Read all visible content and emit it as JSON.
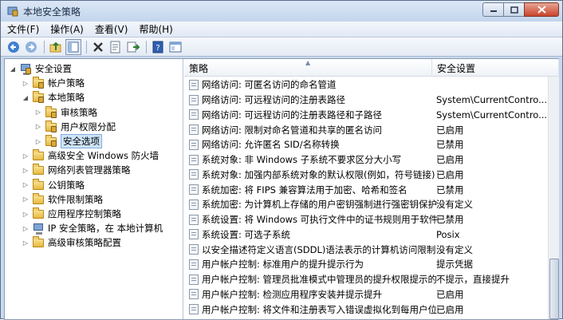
{
  "window": {
    "title": "本地安全策略"
  },
  "menu": [
    "文件(F)",
    "操作(A)",
    "查看(V)",
    "帮助(H)"
  ],
  "toolbar": [
    "back-icon",
    "forward-icon",
    "up-folder-icon",
    "show-hide-tree-icon",
    "delete-icon",
    "properties-icon",
    "export-icon",
    "help-icon",
    "console-icon"
  ],
  "tree": [
    {
      "label": "安全设置",
      "level": 0,
      "expanded": true,
      "icon": "computer-icon"
    },
    {
      "label": "帐户策略",
      "level": 1,
      "expanded": false,
      "icon": "folder-lock-icon"
    },
    {
      "label": "本地策略",
      "level": 1,
      "expanded": true,
      "icon": "folder-lock-icon"
    },
    {
      "label": "审核策略",
      "level": 2,
      "expanded": false,
      "icon": "folder-lock-icon"
    },
    {
      "label": "用户权限分配",
      "level": 2,
      "expanded": false,
      "icon": "folder-lock-icon"
    },
    {
      "label": "安全选项",
      "level": 2,
      "expanded": false,
      "icon": "folder-lock-icon",
      "selected": true
    },
    {
      "label": "高级安全 Windows 防火墙",
      "level": 1,
      "expanded": false,
      "icon": "folder-icon"
    },
    {
      "label": "网络列表管理器策略",
      "level": 1,
      "expanded": false,
      "icon": "folder-icon"
    },
    {
      "label": "公钥策略",
      "level": 1,
      "expanded": false,
      "icon": "folder-icon"
    },
    {
      "label": "软件限制策略",
      "level": 1,
      "expanded": false,
      "icon": "folder-icon"
    },
    {
      "label": "应用程序控制策略",
      "level": 1,
      "expanded": false,
      "icon": "folder-icon"
    },
    {
      "label": "IP 安全策略，在 本地计算机",
      "level": 1,
      "expanded": false,
      "icon": "ipsec-icon"
    },
    {
      "label": "高级审核策略配置",
      "level": 1,
      "expanded": false,
      "icon": "folder-icon"
    }
  ],
  "list": {
    "headers": {
      "policy": "策略",
      "setting": "安全设置"
    },
    "rows": [
      {
        "policy": "网络访问: 可匿名访问的命名管道",
        "setting": ""
      },
      {
        "policy": "网络访问: 可远程访问的注册表路径",
        "setting": "System\\CurrentContro..."
      },
      {
        "policy": "网络访问: 可远程访问的注册表路径和子路径",
        "setting": "System\\CurrentContro..."
      },
      {
        "policy": "网络访问: 限制对命名管道和共享的匿名访问",
        "setting": "已启用"
      },
      {
        "policy": "网络访问: 允许匿名 SID/名称转换",
        "setting": "已禁用"
      },
      {
        "policy": "系统对象: 非 Windows 子系统不要求区分大小写",
        "setting": "已启用"
      },
      {
        "policy": "系统对象: 加强内部系统对象的默认权限(例如，符号链接)",
        "setting": "已启用"
      },
      {
        "policy": "系统加密: 将 FIPS 兼容算法用于加密、哈希和签名",
        "setting": "已禁用"
      },
      {
        "policy": "系统加密: 为计算机上存储的用户密钥强制进行强密钥保护",
        "setting": "没有定义"
      },
      {
        "policy": "系统设置: 将 Windows 可执行文件中的证书规则用于软件...",
        "setting": "已禁用"
      },
      {
        "policy": "系统设置: 可选子系统",
        "setting": "Posix"
      },
      {
        "policy": "以安全描述符定义语言(SDDL)语法表示的计算机访问限制",
        "setting": "没有定义"
      },
      {
        "policy": "用户帐户控制: 标准用户的提升提示行为",
        "setting": "提示凭据"
      },
      {
        "policy": "用户帐户控制: 管理员批准模式中管理员的提升权限提示的...",
        "setting": "不提示，直接提升"
      },
      {
        "policy": "用户帐户控制: 检测应用程序安装并提示提升",
        "setting": "已启用"
      },
      {
        "policy": "用户帐户控制: 将文件和注册表写入错误虚拟化到每用户位置",
        "setting": "已启用"
      }
    ]
  }
}
